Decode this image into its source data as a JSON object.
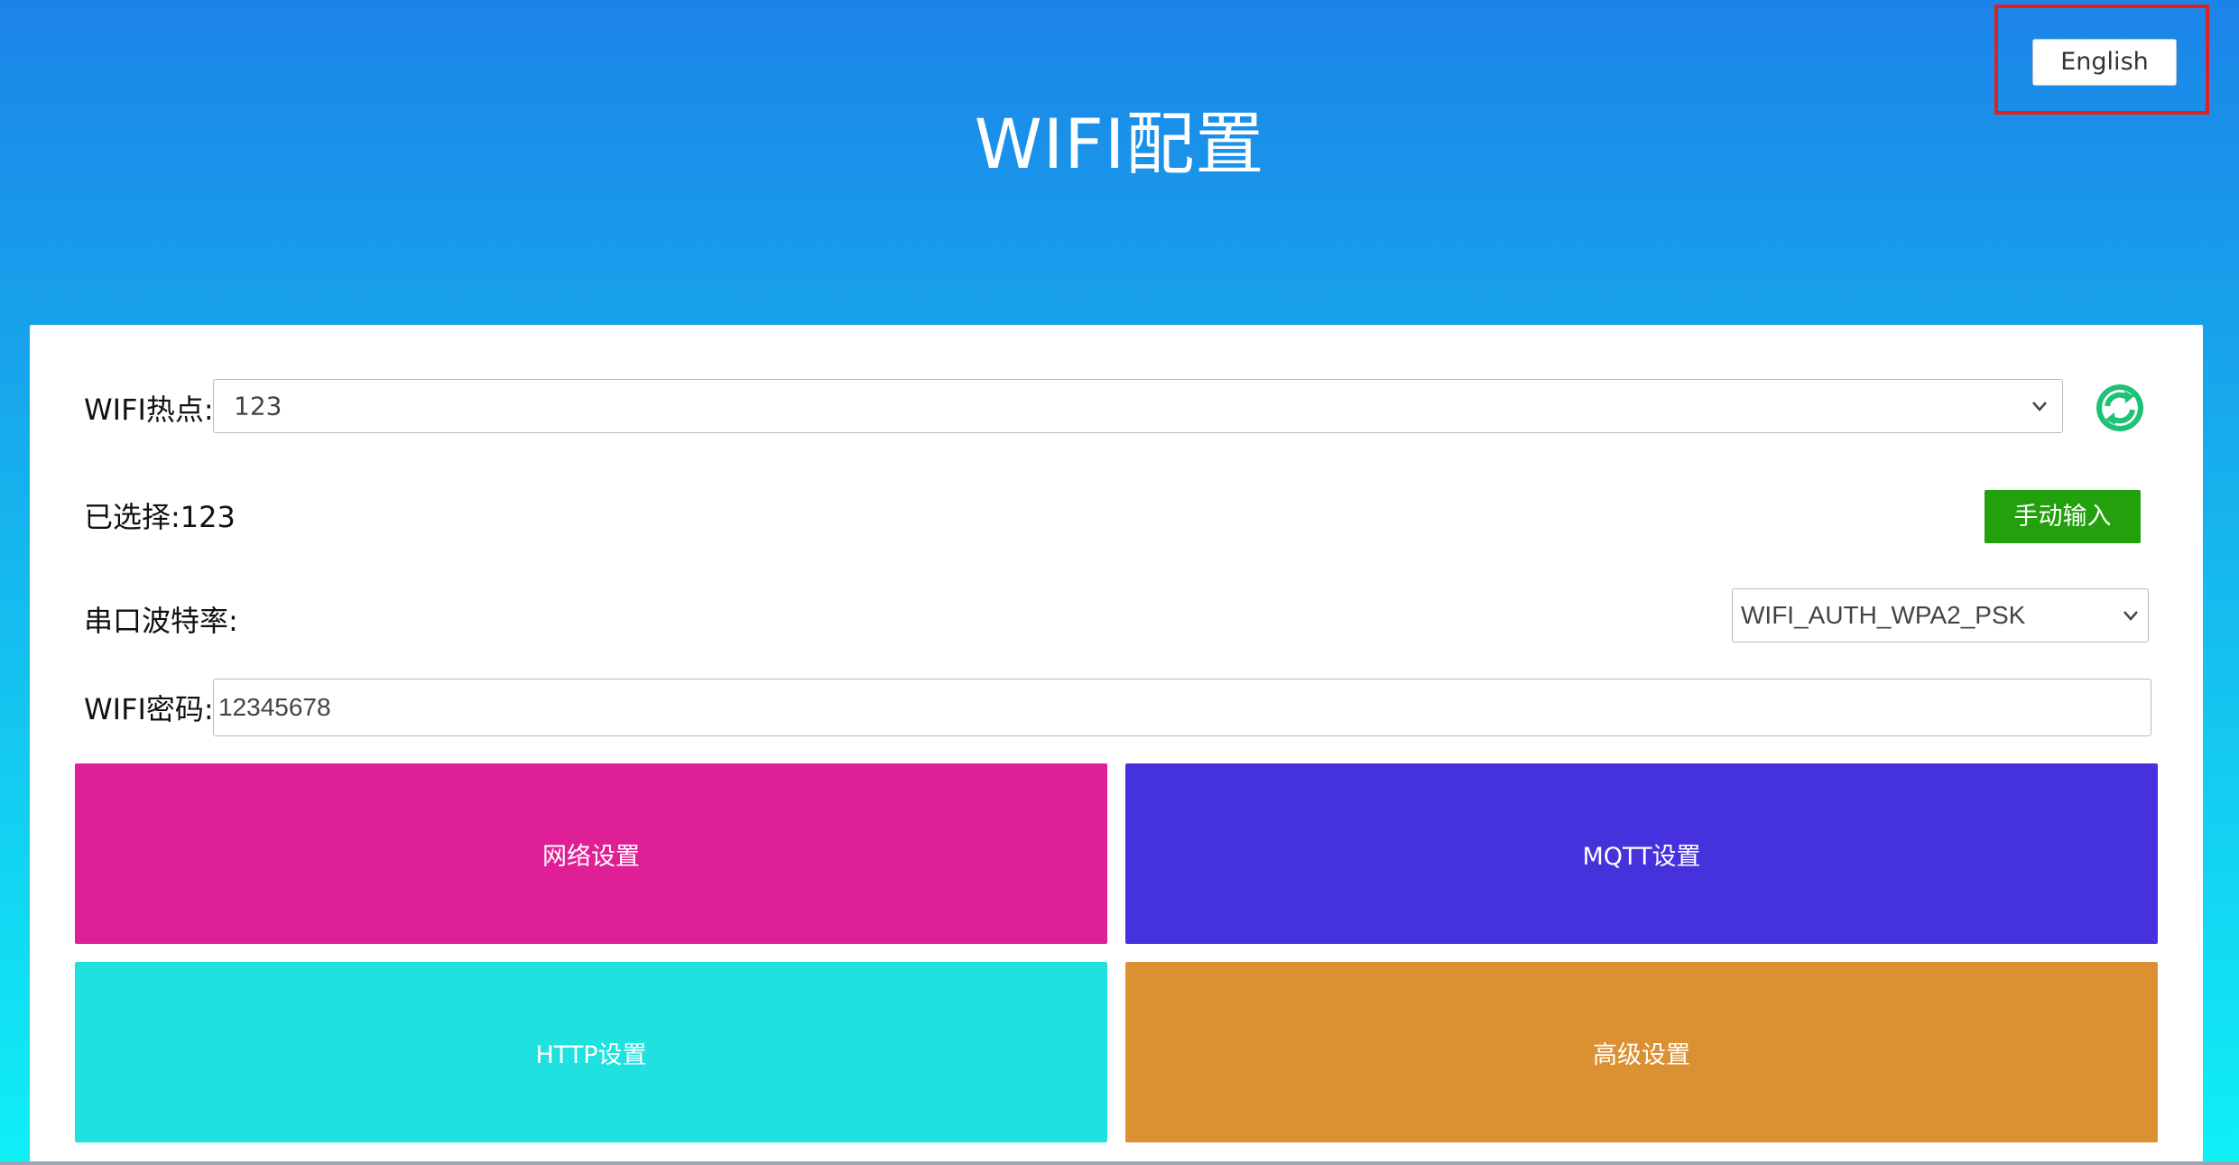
{
  "header": {
    "title": "WIFI配置",
    "language_button": "English"
  },
  "form": {
    "wifi_label": "WIFI热点:",
    "wifi_selected_value": "123",
    "selected_text": "已选择:123",
    "manual_button": "手动输入",
    "baud_label": "串口波特率:",
    "auth_selected_value": "WIFI_AUTH_WPA2_PSK",
    "password_label": "WIFI密码:",
    "password_value": "12345678"
  },
  "tiles": {
    "network": "网络设置",
    "mqtt": "MQTT设置",
    "http": "HTTP设置",
    "advanced": "高级设置"
  },
  "colors": {
    "network": "#df1f95",
    "mqtt": "#4632dc",
    "http": "#1ee1e0",
    "advanced": "#db9132",
    "manual_button": "#22a10c",
    "refresh_icon": "#1fc176"
  },
  "icons": {
    "refresh": "refresh-icon",
    "dropdown": "chevron-down-icon"
  }
}
